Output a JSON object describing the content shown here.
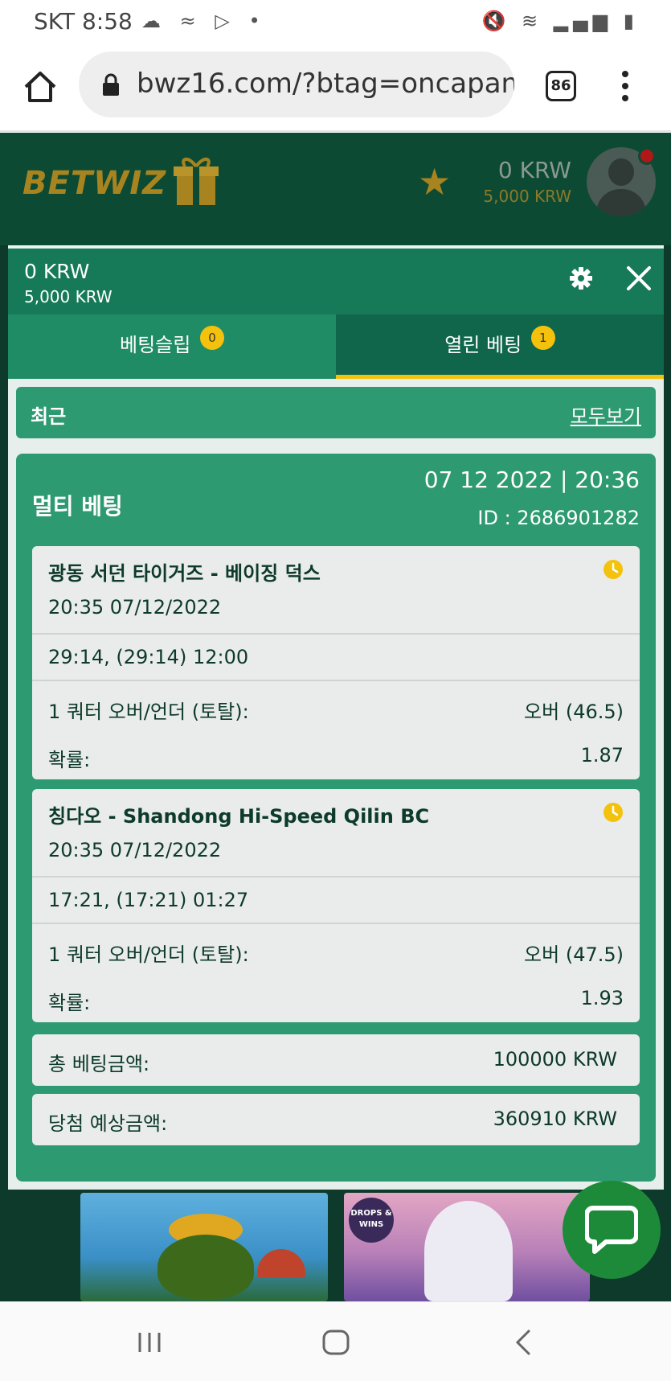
{
  "status_bar": {
    "carrier_time": "SKT 8:58",
    "left_icons": "☁ ≈ ▷ •",
    "right_icons": "🔇 ≋ ▂▄▆ ▮"
  },
  "browser": {
    "url": "bwz16.com/?btag=oncapan&",
    "tab_count": "86"
  },
  "site_header": {
    "logo": "BETWIZ",
    "balance": "0 KRW",
    "bonus": "5,000 KRW"
  },
  "panel": {
    "balance": "0 KRW",
    "bonus": "5,000 KRW",
    "tabs": [
      {
        "label": "베팅슬립",
        "badge": "0"
      },
      {
        "label": "열린 베팅",
        "badge": "1"
      }
    ],
    "recent_label": "최근",
    "view_all": "모두보기",
    "bet": {
      "type": "멀티 베팅",
      "date": "07 12 2022 | 20:36",
      "id": "ID :  2686901282",
      "legs": [
        {
          "match": "광동 서던 타이거즈 - 베이징 덕스",
          "when": "20:35   07/12/2022",
          "score": "29:14, (29:14) 12:00",
          "market": "1 쿼터 오버/언더 (토탈):",
          "pick": "오버 (46.5)",
          "odds_label": "확률:",
          "odds": "1.87"
        },
        {
          "match": "칭다오 - Shandong Hi-Speed Qilin BC",
          "when": "20:35   07/12/2022",
          "score": "17:21, (17:21) 01:27",
          "market": "1 쿼터 오버/언더 (토탈):",
          "pick": "오버 (47.5)",
          "odds_label": "확률:",
          "odds": "1.93"
        }
      ],
      "total_stake_label": "총 베팅금액:",
      "total_stake": "100000 KRW",
      "potential_win_label": "당첨 예상금액:",
      "potential_win": "360910 KRW"
    }
  },
  "games": {
    "tile2_badge": "DROPS & WINS"
  },
  "colors": {
    "brand_green": "#167a58",
    "accent_yellow": "#f4c20d",
    "logo_gold": "#a88420"
  }
}
